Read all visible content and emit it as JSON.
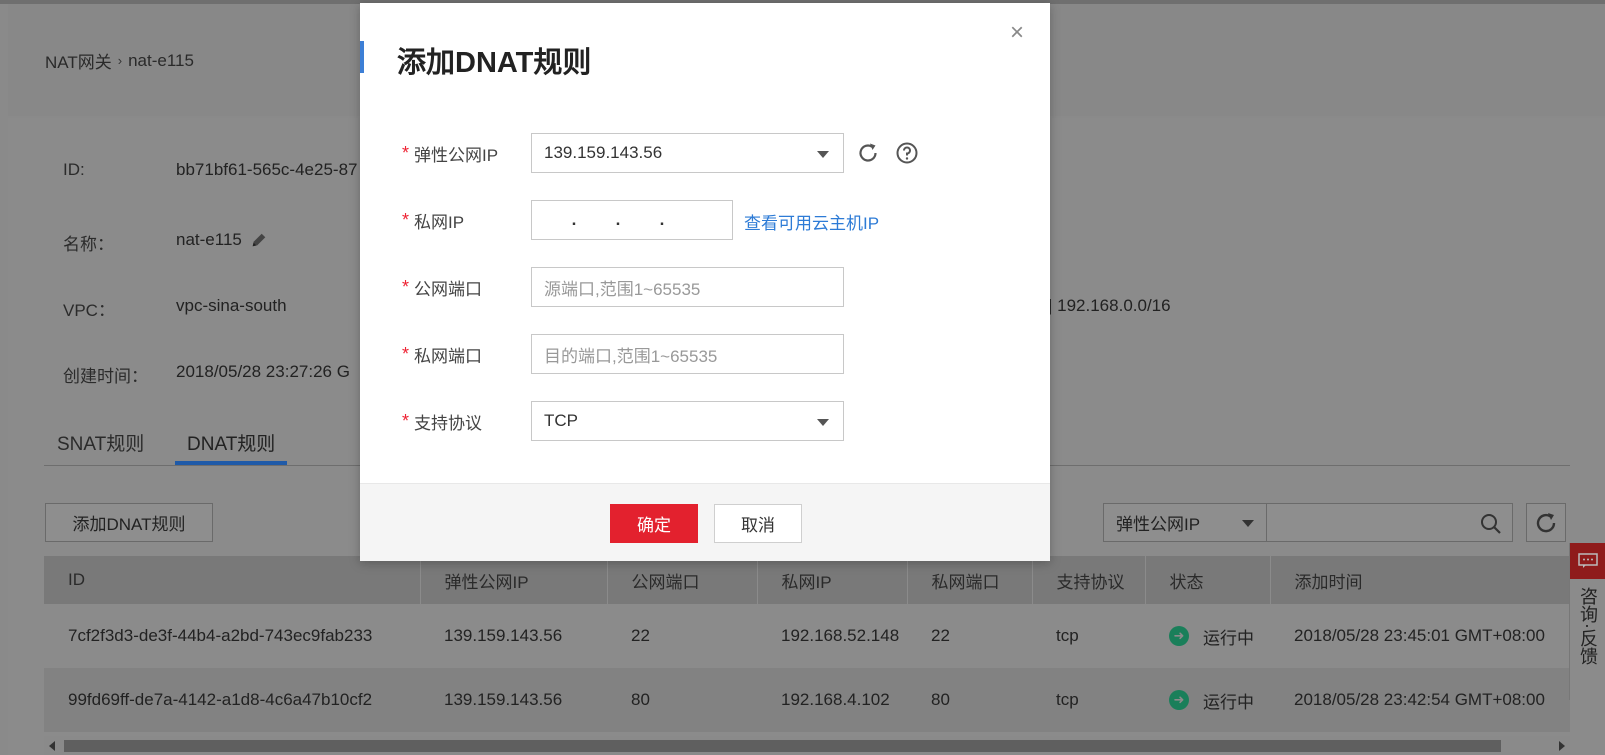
{
  "breadcrumb": {
    "parent": "NAT网关",
    "sep": "›",
    "current": "nat-e115"
  },
  "info": {
    "id_label": "ID:",
    "id_value": "bb71bf61-565c-4e25-87",
    "name_label": "名称：",
    "name_value": "nat-e115",
    "vpc_label": "VPC：",
    "vpc_value": "vpc-sina-south",
    "created_label": "创建时间：",
    "created_value": "2018/05/28 23:27:26 G",
    "cidr_value": "| 192.168.0.0/16"
  },
  "tabs": {
    "snat": "SNAT规则",
    "dnat": "DNAT规则"
  },
  "toolbar": {
    "add_label": "添加DNAT规则",
    "filter_selected": "弹性公网IP"
  },
  "table": {
    "headers": [
      "ID",
      "弹性公网IP",
      "公网端口",
      "私网IP",
      "私网端口",
      "支持协议",
      "状态",
      "添加时间"
    ],
    "rows": [
      [
        "7cf2f3d3-de3f-44b4-a2bd-743ec9fab233",
        "139.159.143.56",
        "22",
        "192.168.52.148",
        "22",
        "tcp",
        "运行中",
        "2018/05/28 23:45:01 GMT+08:00"
      ],
      [
        "99fd69ff-de7a-4142-a1d8-4c6a47b10cf2",
        "139.159.143.56",
        "80",
        "192.168.4.102",
        "80",
        "tcp",
        "运行中",
        "2018/05/28 23:42:54 GMT+08:00"
      ]
    ]
  },
  "feedback": {
    "text": "咨询·反馈"
  },
  "modal": {
    "title": "添加DNAT规则",
    "close": "×",
    "required_mark": "*",
    "eip_label": "弹性公网IP",
    "eip_value": "139.159.143.56",
    "private_ip_label": "私网IP",
    "private_ip_link": "查看可用云主机IP",
    "public_port_label": "公网端口",
    "public_port_placeholder": "源端口,范围1~65535",
    "private_port_label": "私网端口",
    "private_port_placeholder": "目的端口,范围1~65535",
    "protocol_label": "支持协议",
    "protocol_value": "TCP",
    "ok": "确定",
    "cancel": "取消"
  },
  "icons": [
    "refresh-icon",
    "help-icon",
    "search-icon",
    "pencil-icon",
    "chat-icon",
    "running-status-icon"
  ]
}
